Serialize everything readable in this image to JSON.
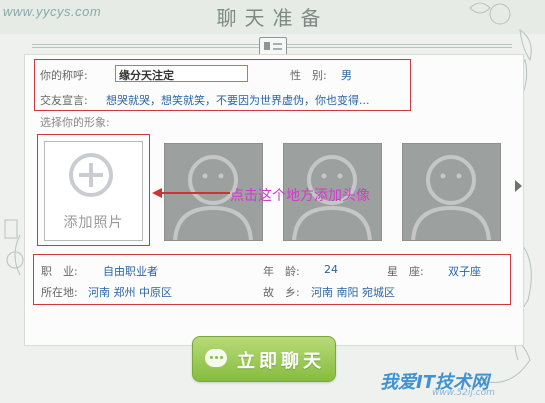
{
  "watermark_top": "www.yycys.com",
  "title": "聊天准备",
  "profile": {
    "nickname_label": "你的称呼:",
    "nickname_value": "缘分天注定",
    "gender_label": "性　别:",
    "gender_value": "男",
    "motto_label": "交友宣言:",
    "motto_value": "想哭就哭，想笑就笑，不要因为世界虚伪，你也变得..."
  },
  "avatar": {
    "select_label": "选择你的形象:",
    "add_label": "添加照片",
    "annotation": "点击这个地方添加头像",
    "slot_count": 3
  },
  "details": {
    "job_label": "职　业:",
    "job_value": "自由职业者",
    "age_label": "年　龄:",
    "age_value": "24",
    "zodiac_label": "星　座:",
    "zodiac_value": "双子座",
    "location_label": "所在地:",
    "location_value": "河南 郑州 中原区",
    "hometown_label": "故　乡:",
    "hometown_value": "河南 南阳 宛城区"
  },
  "chat_button_label": "立即聊天",
  "watermark_bottom": "我爱IT技术网",
  "watermark_bottom_sub": "www.52ij.com",
  "colors": {
    "accent_green": "#86bd3e",
    "value_blue": "#2a65a6",
    "annotation_red": "#d13333",
    "annotation_magenta": "#d13bcc",
    "input_border": "#4f97d8"
  },
  "icons": [
    "profile-card-icon",
    "add-photo-icon",
    "next-arrow-icon",
    "chat-bubble-icon"
  ]
}
